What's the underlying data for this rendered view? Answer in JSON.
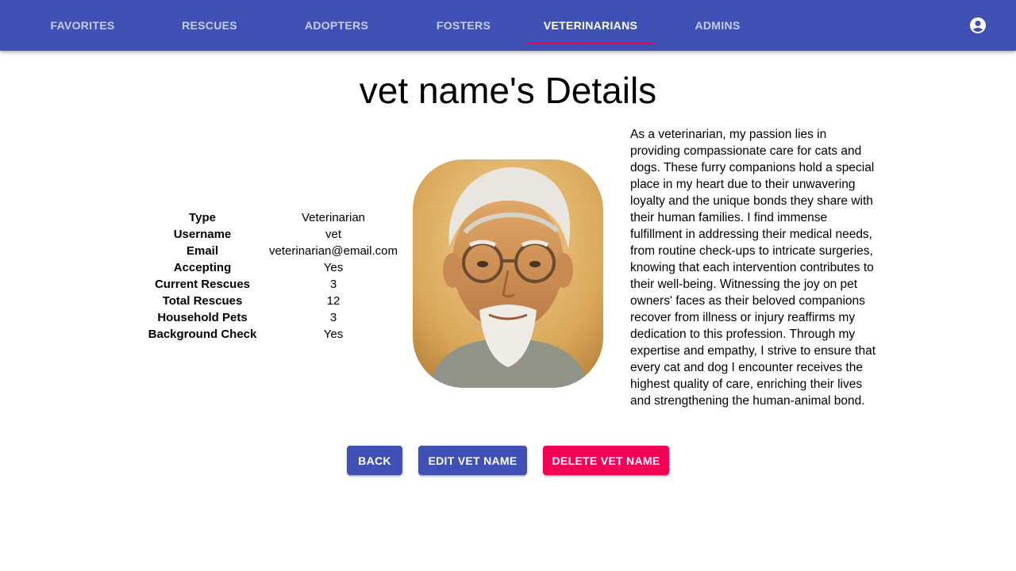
{
  "nav": {
    "tabs": [
      {
        "label": "FAVORITES"
      },
      {
        "label": "RESCUES"
      },
      {
        "label": "ADOPTERS"
      },
      {
        "label": "FOSTERS"
      },
      {
        "label": "VETERINARIANS"
      },
      {
        "label": "ADMINS"
      }
    ],
    "active_tab": "VETERINARIANS",
    "account_icon": "account-circle-icon",
    "bar_color": "#3f51b5",
    "indicator_color": "#f50057"
  },
  "page": {
    "title": "vet name's Details"
  },
  "details": [
    {
      "label": "Type",
      "value": "Veterinarian"
    },
    {
      "label": "Username",
      "value": "vet"
    },
    {
      "label": "Email",
      "value": "veterinarian@email.com"
    },
    {
      "label": "Accepting",
      "value": "Yes"
    },
    {
      "label": "Current Rescues",
      "value": "3"
    },
    {
      "label": "Total Rescues",
      "value": "12"
    },
    {
      "label": "Household Pets",
      "value": "3"
    },
    {
      "label": "Background Check",
      "value": "Yes"
    }
  ],
  "bio": "As a veterinarian, my passion lies in providing compassionate care for cats and dogs. These furry companions hold a special place in my heart due to their unwavering loyalty and the unique bonds they share with their human families. I find immense fulfillment in addressing their medical needs, from routine check-ups to intricate surgeries, knowing that each intervention contributes to their well-being. Witnessing the joy on pet owners' faces as their beloved companions recover from illness or injury reaffirms my dedication to this profession. Through my expertise and empathy, I strive to ensure that every cat and dog I encounter receives the highest quality of care, enriching their lives and strengthening the human-animal bond.",
  "actions": {
    "back": "BACK",
    "edit": "EDIT VET NAME",
    "delete": "DELETE VET NAME",
    "primary_color": "#3f51b5",
    "danger_color": "#f50057"
  }
}
